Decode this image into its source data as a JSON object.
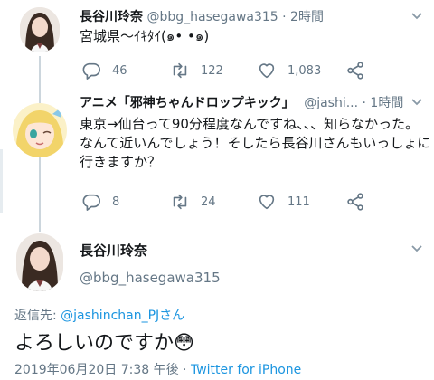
{
  "tweet1": {
    "name": "長谷川玲奈",
    "handle": "@bbg_hasegawa315",
    "time": "· 2時間",
    "text": "宮城県〜ｲｷﾀｲ(๑• •๑)",
    "reply_count": "46",
    "retweet_count": "122",
    "like_count": "1,083"
  },
  "tweet2": {
    "name": "アニメ「邪神ちゃんドロップキック」",
    "handle": "@jashi...",
    "time": "· 1時間",
    "text_line1": "東京→仙台って90分程度なんですね、、、知らなかった。",
    "text_line2": "なんて近いんでしょう！そしたら長谷川さんもいっしょに",
    "text_line3": "行きますか？",
    "reply_count": "8",
    "retweet_count": "24",
    "like_count": "111"
  },
  "focused": {
    "name": "長谷川玲奈",
    "handle": "@bbg_hasegawa315",
    "reply_label": "返信先:",
    "reply_mention": "@jashinchan_PJさん",
    "text": "よろしいのですか😳",
    "timestamp": "2019年06月20日 7:38 午後 ·",
    "client": "Twitter for iPhone"
  },
  "colors": {
    "link": "#1b95e0",
    "secondary": "#657786",
    "thread_line": "#ccd6dd"
  }
}
